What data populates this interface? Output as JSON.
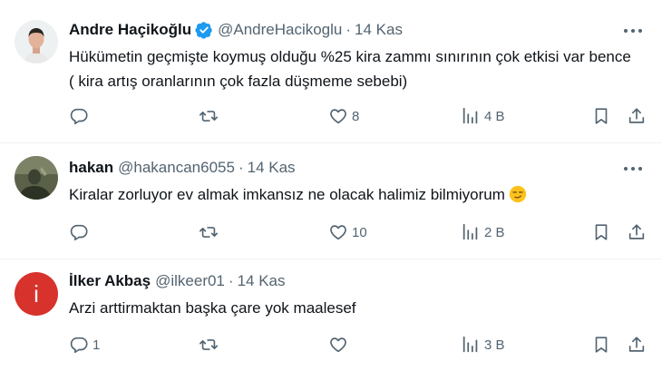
{
  "tweets": [
    {
      "name": "Andre Haçikoğlu",
      "verified": true,
      "handle": "@AndreHacikoglu",
      "date": "14 Kas",
      "text": "Hükümetin geçmişte koymuş olduğu %25 kira zammı sınırının çok etkisi var bence ( kira artış oranlarının çok fazla düşmeme sebebi)",
      "replies": "",
      "retweets": "",
      "likes": "8",
      "views": "4 B"
    },
    {
      "name": "hakan",
      "verified": false,
      "handle": "@hakancan6055",
      "date": "14 Kas",
      "text": "Kiralar zorluyor ev almak imkansız ne olacak halimiz bilmiyorum",
      "replies": "",
      "retweets": "",
      "likes": "10",
      "views": "2 B"
    },
    {
      "name": "İlker Akbaş",
      "verified": false,
      "handle": "@ilkeer01",
      "date": "14 Kas",
      "avatar_letter": "i",
      "text": "Arzi arttirmaktan başka çare yok maalesef",
      "replies": "1",
      "retweets": "",
      "likes": "",
      "views": "3 B"
    }
  ],
  "separator": "·",
  "colors": {
    "text": "#0f1419",
    "secondary": "#536471",
    "verified_blue": "#1d9bf0",
    "avatar3_red": "#d7322b",
    "divider": "#eff3f4"
  },
  "icons": [
    "reply-icon",
    "retweet-icon",
    "like-icon",
    "views-icon",
    "bookmark-icon",
    "share-icon",
    "more-icon",
    "verified-badge-icon",
    "smirk-emoji"
  ]
}
